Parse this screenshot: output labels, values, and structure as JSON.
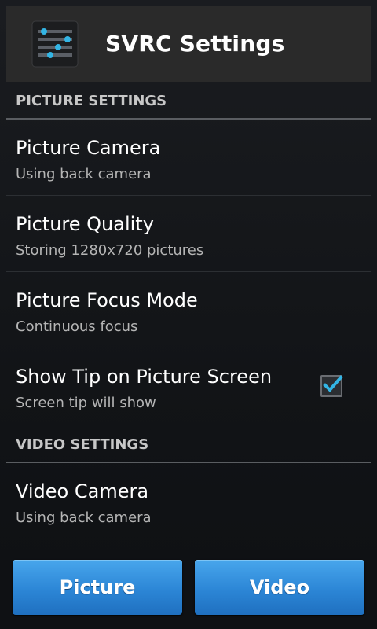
{
  "app": {
    "title": "SVRC Settings",
    "icon": "sliders-icon"
  },
  "sections": [
    {
      "header": "PICTURE SETTINGS",
      "items": [
        {
          "title": "Picture Camera",
          "summary": "Using back camera"
        },
        {
          "title": "Picture Quality",
          "summary": "Storing 1280x720 pictures"
        },
        {
          "title": "Picture Focus Mode",
          "summary": "Continuous focus"
        },
        {
          "title": "Show Tip on Picture Screen",
          "summary": "Screen tip will show",
          "checked": true
        }
      ]
    },
    {
      "header": "VIDEO SETTINGS",
      "items": [
        {
          "title": "Video Camera",
          "summary": "Using back camera"
        }
      ]
    }
  ],
  "buttons": {
    "picture": "Picture",
    "video": "Video"
  },
  "colors": {
    "accent": "#33b5e5",
    "button": "#2c86d6"
  }
}
